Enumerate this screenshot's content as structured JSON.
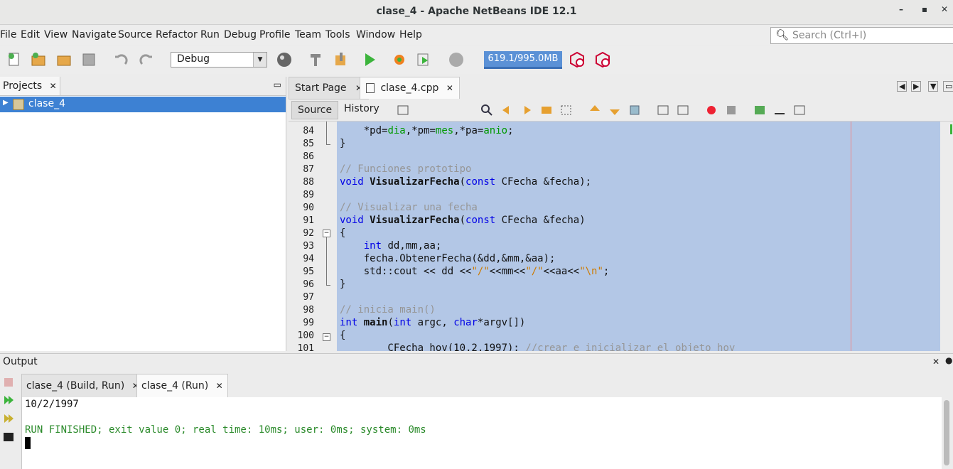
{
  "window": {
    "title": "clase_4 - Apache NetBeans IDE 12.1"
  },
  "menu": [
    "File",
    "Edit",
    "View",
    "Navigate",
    "Source",
    "Refactor",
    "Run",
    "Debug",
    "Profile",
    "Team",
    "Tools",
    "Window",
    "Help"
  ],
  "search": {
    "placeholder": "Search (Ctrl+I)"
  },
  "toolbar": {
    "config": "Debug",
    "memory": "619.1/995.0MB"
  },
  "projects": {
    "tab_label": "Projects",
    "root": "clase_4"
  },
  "editor": {
    "tabs": [
      "Start Page",
      "clase_4.cpp"
    ],
    "subtabs": {
      "source": "Source",
      "history": "History"
    },
    "lines": [
      {
        "n": "84",
        "text": "    *pd=dia,*pm=mes,*pa=anio;"
      },
      {
        "n": "85",
        "text": "}"
      },
      {
        "n": "86",
        "text": ""
      },
      {
        "n": "87",
        "text": "// Funciones prototipo"
      },
      {
        "n": "88",
        "text": "void VisualizarFecha(const CFecha &fecha);"
      },
      {
        "n": "89",
        "text": ""
      },
      {
        "n": "90",
        "text": "// Visualizar una fecha"
      },
      {
        "n": "91",
        "text": "void VisualizarFecha(const CFecha &fecha)"
      },
      {
        "n": "92",
        "text": "{"
      },
      {
        "n": "93",
        "text": "    int dd,mm,aa;"
      },
      {
        "n": "94",
        "text": "    fecha.ObtenerFecha(&dd,&mm,&aa);"
      },
      {
        "n": "95",
        "text": "    std::cout << dd <<\"/\"<<mm<<\"/\"<<aa<<\"\\n\";"
      },
      {
        "n": "96",
        "text": "}"
      },
      {
        "n": "97",
        "text": ""
      },
      {
        "n": "98",
        "text": "// inicia main()"
      },
      {
        "n": "99",
        "text": "int main(int argc, char*argv[])"
      },
      {
        "n": "100",
        "text": "{"
      },
      {
        "n": "101",
        "text": "        CFecha hoy(10,2,1997); //crear e inicializar el objeto hoy"
      }
    ]
  },
  "output": {
    "title": "Output",
    "tabs": [
      "clase_4 (Build, Run)",
      "clase_4 (Run)"
    ],
    "lines": [
      "10/2/1997",
      "",
      "RUN FINISHED; exit value 0; real time: 10ms; user: 0ms; system: 0ms"
    ]
  }
}
